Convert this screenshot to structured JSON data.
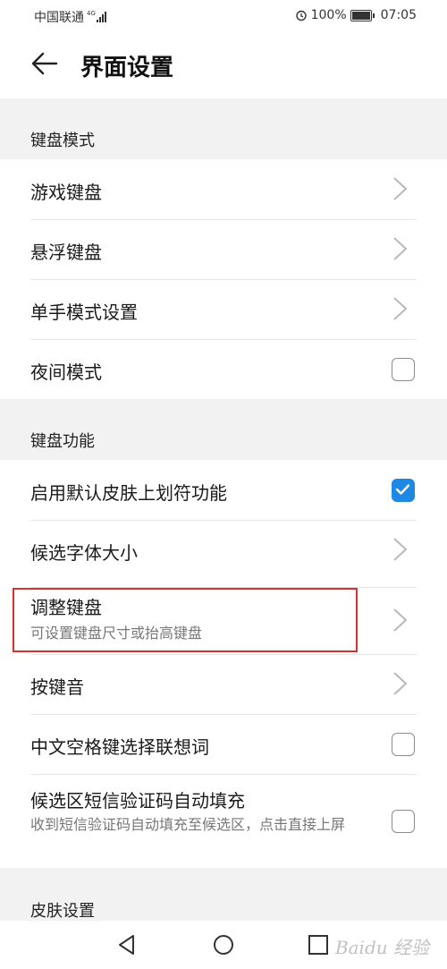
{
  "status_bar": {
    "carrier": "中国联通",
    "network": "4G",
    "battery": "100%",
    "time": "07:05"
  },
  "header": {
    "title": "界面设置"
  },
  "sections": {
    "keyboard_mode": {
      "label": "键盘模式",
      "items": [
        {
          "label": "游戏键盘",
          "control": "chevron"
        },
        {
          "label": "悬浮键盘",
          "control": "chevron"
        },
        {
          "label": "单手模式设置",
          "control": "chevron"
        },
        {
          "label": "夜间模式",
          "control": "checkbox",
          "checked": false
        }
      ]
    },
    "keyboard_function": {
      "label": "键盘功能",
      "items": [
        {
          "label": "启用默认皮肤上划符功能",
          "control": "checkbox",
          "checked": true
        },
        {
          "label": "候选字体大小",
          "control": "chevron"
        },
        {
          "label": "调整键盘",
          "sublabel": "可设置键盘尺寸或抬高键盘",
          "control": "chevron",
          "highlighted": true
        },
        {
          "label": "按键音",
          "control": "chevron"
        },
        {
          "label": "中文空格键选择联想词",
          "control": "checkbox",
          "checked": false
        },
        {
          "label": "候选区短信验证码自动填充",
          "sublabel": "收到短信验证码自动填充至候选区，点击直接上屏",
          "control": "checkbox",
          "checked": false
        }
      ]
    },
    "skin": {
      "label": "皮肤设置"
    }
  },
  "colors": {
    "accent": "#1e88e5",
    "highlight_border": "#d93030",
    "background": "#f2f2f2"
  },
  "watermark": "Baidu 经验"
}
